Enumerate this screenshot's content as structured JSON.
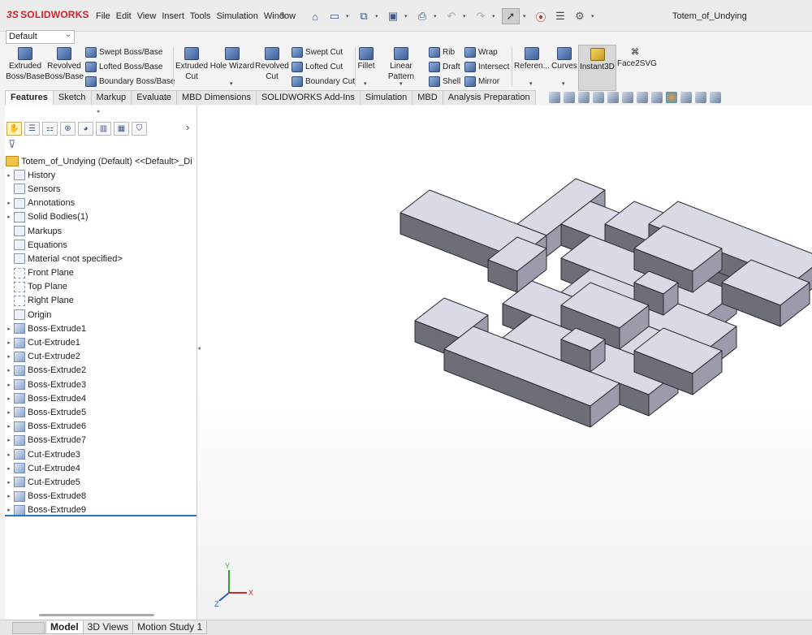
{
  "app": {
    "logo": "SOLIDWORKS",
    "logo_prefix": "3S",
    "document_title": "Totem_of_Undying"
  },
  "menu": [
    "File",
    "Edit",
    "View",
    "Insert",
    "Tools",
    "Simulation",
    "Window"
  ],
  "quick_access": [
    "home-icon",
    "new-document-icon",
    "open-icon",
    "save-icon",
    "print-icon",
    "undo-icon",
    "redo-icon",
    "select-icon",
    "rebuild-icon",
    "file-properties-icon",
    "options-icon"
  ],
  "configuration": {
    "value": "Default"
  },
  "commands": {
    "extruded_boss": "Extruded Boss/Base",
    "revolved_boss": "Revolved Boss/Base",
    "swept_boss": "Swept Boss/Base",
    "lofted_boss": "Lofted Boss/Base",
    "boundary_boss": "Boundary Boss/Base",
    "extruded_cut": "Extruded Cut",
    "hole_wizard": "Hole Wizard",
    "revolved_cut": "Revolved Cut",
    "swept_cut": "Swept Cut",
    "lofted_cut": "Lofted Cut",
    "boundary_cut": "Boundary Cut",
    "fillet": "Fillet",
    "linear_pattern": "Linear Pattern",
    "rib": "Rib",
    "wrap": "Wrap",
    "draft": "Draft",
    "intersect": "Intersect",
    "shell": "Shell",
    "mirror": "Mirror",
    "reference": "Referen...",
    "curves": "Curves",
    "instant3d": "Instant3D",
    "face2svg": "Face2SVG"
  },
  "tabs": [
    "Features",
    "Sketch",
    "Markup",
    "Evaluate",
    "MBD Dimensions",
    "SOLIDWORKS Add-Ins",
    "Simulation",
    "MBD",
    "Analysis Preparation"
  ],
  "active_tab": "Features",
  "feature_tree": {
    "root": "Totem_of_Undying (Default) <<Default>_Di",
    "items": [
      {
        "label": "History",
        "icon": "history-icon",
        "expand": true
      },
      {
        "label": "Sensors",
        "icon": "sensor-icon",
        "expand": false
      },
      {
        "label": "Annotations",
        "icon": "annotations-icon",
        "expand": true
      },
      {
        "label": "Solid Bodies(1)",
        "icon": "solid-bodies-icon",
        "expand": true
      },
      {
        "label": "Markups",
        "icon": "markups-icon",
        "expand": false
      },
      {
        "label": "Equations",
        "icon": "equations-icon",
        "expand": false
      },
      {
        "label": "Material <not specified>",
        "icon": "material-icon",
        "expand": false
      },
      {
        "label": "Front Plane",
        "icon": "plane-icon",
        "expand": false
      },
      {
        "label": "Top Plane",
        "icon": "plane-icon",
        "expand": false
      },
      {
        "label": "Right Plane",
        "icon": "plane-icon",
        "expand": false
      },
      {
        "label": "Origin",
        "icon": "origin-icon",
        "expand": false
      },
      {
        "label": "Boss-Extrude1",
        "icon": "boss-extrude-icon",
        "expand": true
      },
      {
        "label": "Cut-Extrude1",
        "icon": "cut-extrude-icon",
        "expand": true
      },
      {
        "label": "Cut-Extrude2",
        "icon": "cut-extrude-icon",
        "expand": true
      },
      {
        "label": "Boss-Extrude2",
        "icon": "boss-extrude-icon",
        "expand": true
      },
      {
        "label": "Boss-Extrude3",
        "icon": "boss-extrude-icon",
        "expand": true
      },
      {
        "label": "Boss-Extrude4",
        "icon": "boss-extrude-icon",
        "expand": true
      },
      {
        "label": "Boss-Extrude5",
        "icon": "boss-extrude-icon",
        "expand": true
      },
      {
        "label": "Boss-Extrude6",
        "icon": "boss-extrude-icon",
        "expand": true
      },
      {
        "label": "Boss-Extrude7",
        "icon": "boss-extrude-icon",
        "expand": true
      },
      {
        "label": "Cut-Extrude3",
        "icon": "cut-extrude-icon",
        "expand": true
      },
      {
        "label": "Cut-Extrude4",
        "icon": "cut-extrude-icon",
        "expand": true
      },
      {
        "label": "Cut-Extrude5",
        "icon": "cut-extrude-icon",
        "expand": true
      },
      {
        "label": "Boss-Extrude8",
        "icon": "boss-extrude-icon",
        "expand": true
      },
      {
        "label": "Boss-Extrude9",
        "icon": "boss-extrude-icon",
        "expand": true
      }
    ]
  },
  "bottom_tabs": [
    "Model",
    "3D Views",
    "Motion Study 1"
  ],
  "active_bottom_tab": "Model",
  "triad": {
    "x": "X",
    "y": "Y",
    "z": "Z"
  },
  "colors": {
    "model_top": "#d8dae6",
    "model_left": "#6d6f78",
    "model_right": "#9a9cab",
    "accent": "#2b78c5",
    "logo_red": "#d2232a"
  }
}
